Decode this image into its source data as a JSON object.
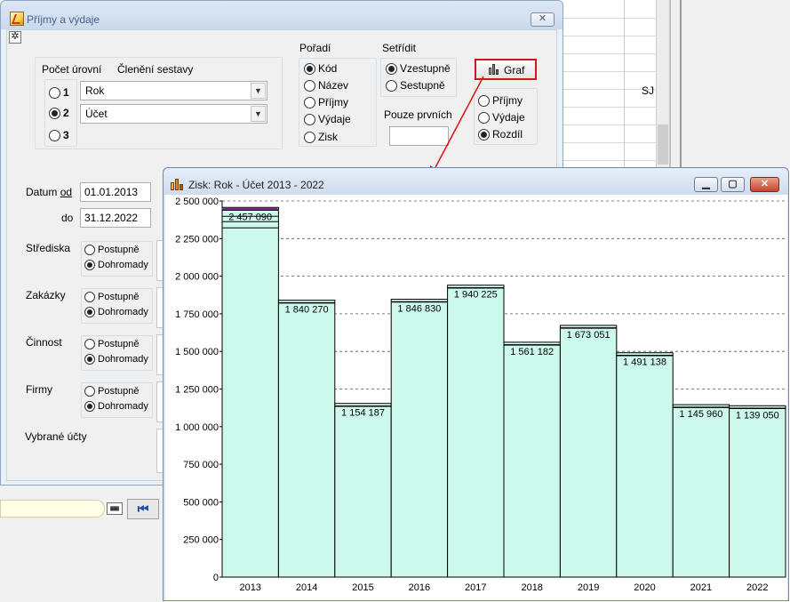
{
  "background": {
    "grid_cell_text": "SJ"
  },
  "filter_window": {
    "title": "Příjmy a výdaje",
    "close_symbol": "✕",
    "settings_icon": "gear-icon",
    "levels": {
      "header_count": "Počet úrovní",
      "header_structure": "Členění sestavy",
      "options": [
        "1",
        "2",
        "3"
      ],
      "selected": "2",
      "level1_value": "Rok",
      "level2_value": "Účet"
    },
    "order": {
      "label": "Pořadí",
      "options": [
        "Kód",
        "Název",
        "Příjmy",
        "Výdaje",
        "Zisk"
      ],
      "selected": "Kód"
    },
    "sort": {
      "label": "Setřídit",
      "options": [
        "Vzestupně",
        "Sestupně"
      ],
      "selected": "Vzestupně"
    },
    "first_only": {
      "label": "Pouze prvních",
      "value": ""
    },
    "graph_button": "Graf",
    "graph_type": {
      "options": [
        "Příjmy",
        "Výdaje",
        "Rozdíl"
      ],
      "selected": "Rozdíl"
    },
    "date_from": {
      "label_prefix": "Datum ",
      "label_underlined": "od",
      "value": "01.01.2013"
    },
    "date_to": {
      "label": "do",
      "value": "31.12.2022"
    },
    "sections": [
      {
        "label": "Střediska",
        "option_progressive": "Postupně",
        "option_total": "Dohromady",
        "selected": "Dohromady"
      },
      {
        "label": "Zakázky",
        "option_progressive": "Postupně",
        "option_total": "Dohromady",
        "selected": "Dohromady"
      },
      {
        "label": "Činnost",
        "option_progressive": "Postupně",
        "option_total": "Dohromady",
        "selected": "Dohromady"
      },
      {
        "label": "Firmy",
        "option_progressive": "Postupně",
        "option_total": "Dohromady",
        "selected": "Dohromady"
      }
    ],
    "selected_accounts_label": "Vybrané účty"
  },
  "bottom_bar": {
    "nav_icon": "db-icon",
    "nav_first_symbol": "⏮"
  },
  "chart_window": {
    "title": "Zisk: Rok - Účet 2013 - 2022",
    "btn_minimize": "▁",
    "btn_maximize": "▢",
    "btn_close": "✕",
    "colors": {
      "bar_fill": "#cdf9ed",
      "bar_stroke": "#000000",
      "grid": "#555555",
      "accent_2013": "#7a2a86"
    }
  },
  "chart_data": {
    "type": "bar",
    "title": "",
    "xlabel": "",
    "ylabel": "",
    "categories": [
      "2013",
      "2014",
      "2015",
      "2016",
      "2017",
      "2018",
      "2019",
      "2020",
      "2021",
      "2022"
    ],
    "values": [
      2457090,
      1840270,
      1154187,
      1846830,
      1940225,
      1561182,
      1673051,
      1491138,
      1145960,
      1139050
    ],
    "value_labels": [
      "2 457 090",
      "1 840 270",
      "1 154 187",
      "1 846 830",
      "1 940 225",
      "1 561 182",
      "1 673 051",
      "1 491 138",
      "1 145 960",
      "1 139 050"
    ],
    "ylim": [
      0,
      2500000
    ],
    "yticks": [
      0,
      250000,
      500000,
      750000,
      1000000,
      1250000,
      1500000,
      1750000,
      2000000,
      2250000,
      2500000
    ],
    "ytick_labels": [
      "0",
      "250 000",
      "500 000",
      "750 000",
      "1 000 000",
      "1 250 000",
      "1 500 000",
      "1 750 000",
      "2 000 000",
      "2 250 000",
      "2 500 000"
    ],
    "grid": true,
    "legend": "none"
  }
}
